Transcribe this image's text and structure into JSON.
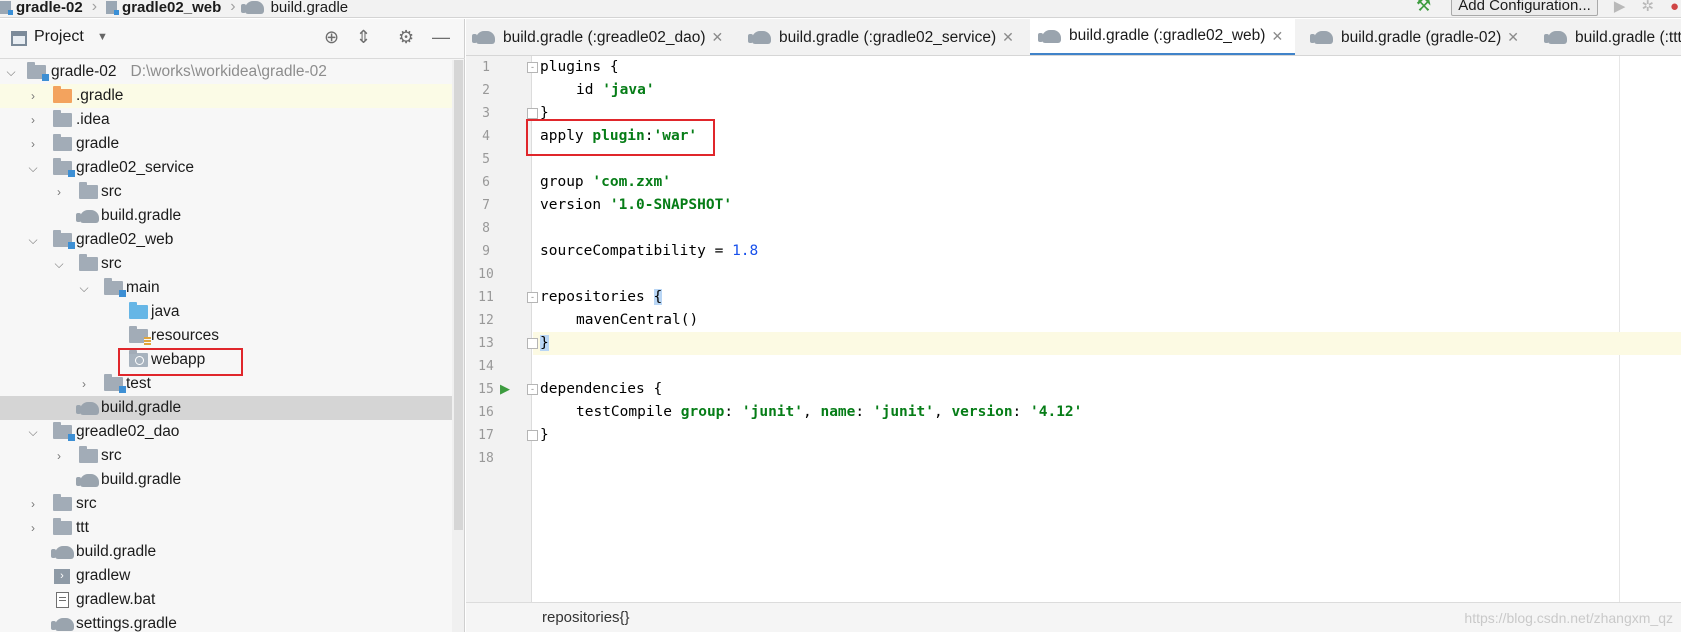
{
  "breadcrumbs": [
    "gradle-02",
    "gradle02_web",
    "build.gradle"
  ],
  "toolbar": {
    "add_configuration": "Add Configuration..."
  },
  "panel": {
    "title": "Project"
  },
  "tree": {
    "root": {
      "label": "gradle-02",
      "path": "D:\\works\\workidea\\gradle-02"
    },
    "items": [
      {
        "label": ".gradle"
      },
      {
        "label": ".idea"
      },
      {
        "label": "gradle"
      },
      {
        "label": "gradle02_service"
      },
      {
        "label": "src"
      },
      {
        "label": "build.gradle"
      },
      {
        "label": "gradle02_web"
      },
      {
        "label": "src"
      },
      {
        "label": "main"
      },
      {
        "label": "java"
      },
      {
        "label": "resources"
      },
      {
        "label": "webapp"
      },
      {
        "label": "test"
      },
      {
        "label": "build.gradle"
      },
      {
        "label": "greadle02_dao"
      },
      {
        "label": "src"
      },
      {
        "label": "build.gradle"
      },
      {
        "label": "src"
      },
      {
        "label": "ttt"
      },
      {
        "label": "build.gradle"
      },
      {
        "label": "gradlew"
      },
      {
        "label": "gradlew.bat"
      },
      {
        "label": "settings.gradle"
      }
    ]
  },
  "tabs": [
    {
      "label": "build.gradle (:greadle02_dao)"
    },
    {
      "label": "build.gradle (:gradle02_service)"
    },
    {
      "label": "build.gradle (:gradle02_web)"
    },
    {
      "label": "build.gradle (gradle-02)"
    },
    {
      "label": "build.gradle (:ttt"
    }
  ],
  "editor": {
    "line_numbers": [
      "1",
      "2",
      "3",
      "4",
      "5",
      "6",
      "7",
      "8",
      "9",
      "10",
      "11",
      "12",
      "13",
      "14",
      "15",
      "16",
      "17",
      "18"
    ],
    "current_line": "13",
    "code": {
      "l1_kw": "plugins",
      "l1_rest": " {",
      "l2_kw": "id",
      "l2_str": "'java'",
      "l3": "}",
      "l4_kw": "apply ",
      "l4_named": "plugin",
      "l4_colon": ":",
      "l4_str": "'war'",
      "l6_kw": "group ",
      "l6_str": "'com.zxm'",
      "l7_kw": "version ",
      "l7_str": "'1.0-SNAPSHOT'",
      "l9_kw": "sourceCompatibility = ",
      "l9_num": "1.8",
      "l11_kw": "repositories ",
      "l11_brace": "{",
      "l12": "mavenCentral()",
      "l13": "}",
      "l15_kw": "dependencies",
      "l15_rest": " {",
      "l16_kw": "testCompile ",
      "l16_n1": "group",
      "l16_c1": ": ",
      "l16_v1": "'junit'",
      "l16_sep1": ", ",
      "l16_n2": "name",
      "l16_c2": ": ",
      "l16_v2": "'junit'",
      "l16_sep2": ", ",
      "l16_n3": "version",
      "l16_c3": ": ",
      "l16_v3": "'4.12'",
      "l17": "}"
    }
  },
  "status": {
    "breadcrumb": "repositories{}"
  },
  "watermark": "https://blog.csdn.net/zhangxm_qz",
  "colors": {
    "accent": "#4083c9",
    "annotation": "#e0262b",
    "string": "#067d17",
    "keyword": "#000080",
    "number": "#1750eb"
  }
}
